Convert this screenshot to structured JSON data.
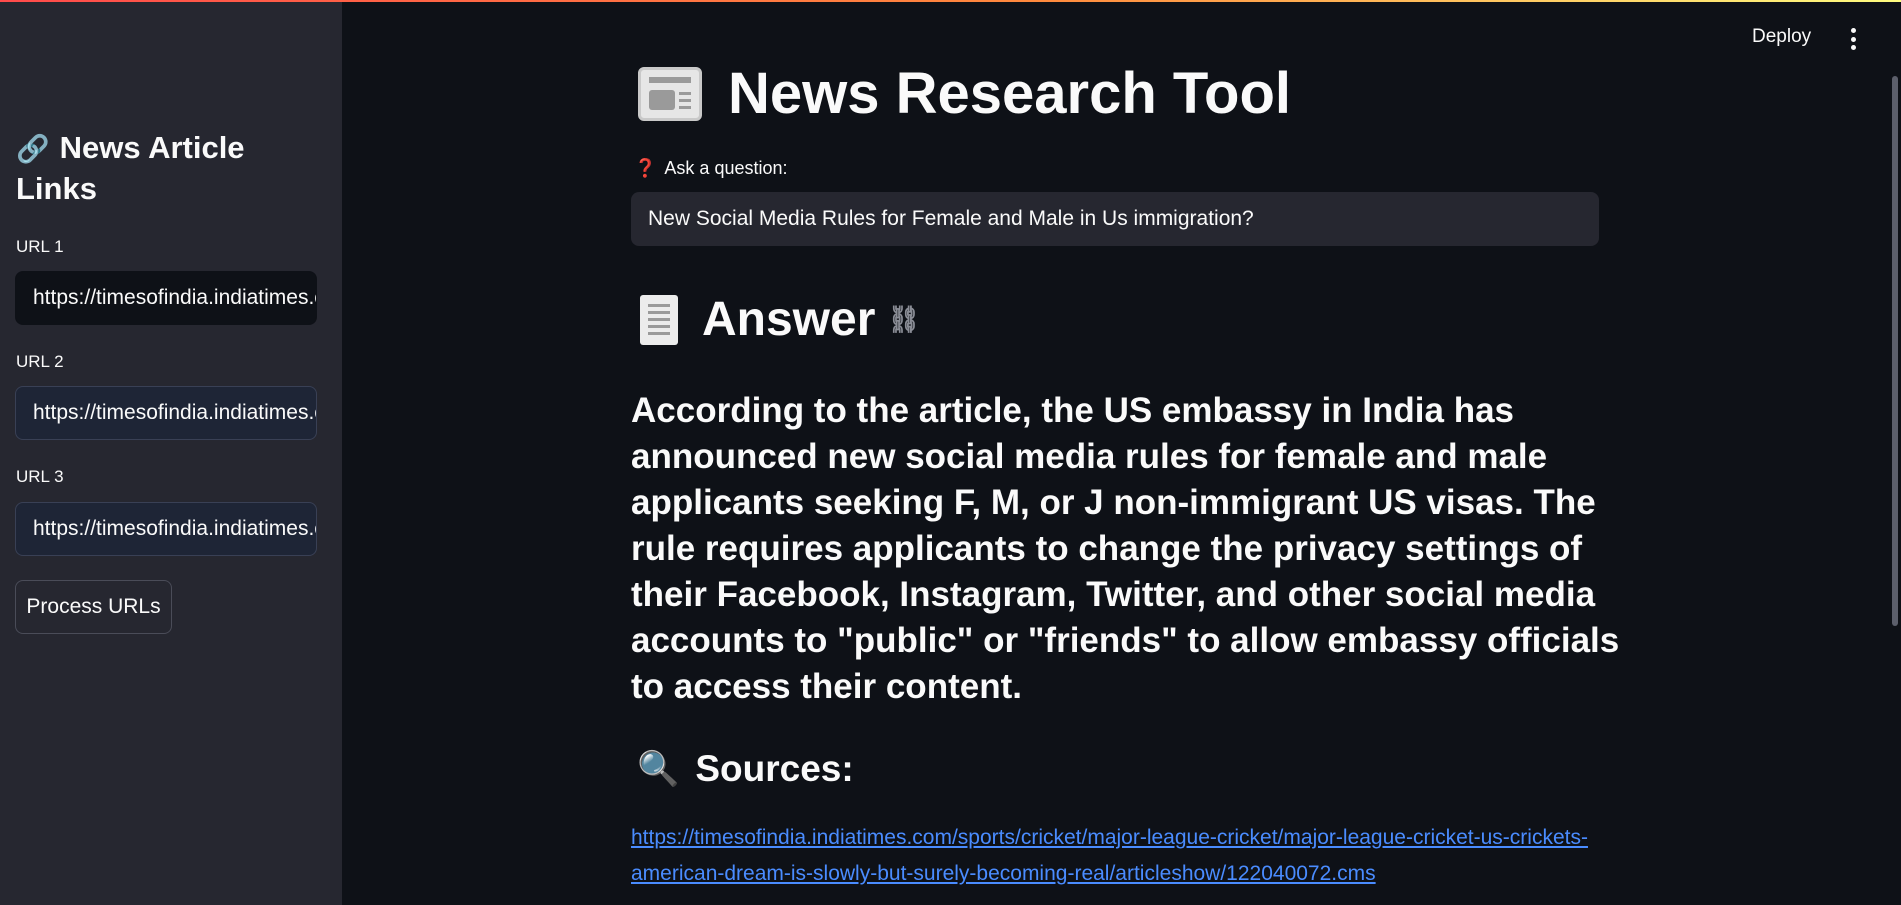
{
  "sidebar": {
    "title_icon": "🔗",
    "title": "News Article Links",
    "urls": [
      {
        "label": "URL 1",
        "value": "https://timesofindia.indiatimes.com/"
      },
      {
        "label": "URL 2",
        "value": "https://timesofindia.indiatimes.com/"
      },
      {
        "label": "URL 3",
        "value": "https://timesofindia.indiatimes.com/"
      }
    ],
    "process_button": "Process URLs"
  },
  "header": {
    "deploy_label": "Deploy",
    "menu_icon": "more-vert-icon"
  },
  "main": {
    "title": "News Research Tool",
    "title_icon": "newspaper-icon",
    "question_label": "Ask a question:",
    "question_icon": "❓",
    "question_value": "New Social Media Rules for Female and Male in Us immigration?",
    "answer_heading": "Answer",
    "answer_icon": "receipt-icon",
    "anchor_icon": "⛓",
    "answer_text": "According to the article, the US embassy in India has announced new social media rules for female and male applicants seeking F, M, or J non-immigrant US visas. The rule requires applicants to change the privacy settings of their Facebook, Instagram, Twitter, and other social media accounts to \"public\" or \"friends\" to allow embassy officials to access their content.",
    "sources_heading": "Sources:",
    "sources_icon": "🔍",
    "sources": [
      "https://timesofindia.indiatimes.com/sports/cricket/major-league-cricket/major-league-cricket-us-crickets-american-dream-is-slowly-but-surely-becoming-real/articleshow/122040072.cms"
    ]
  },
  "colors": {
    "background": "#0e1117",
    "sidebar": "#262730",
    "link": "#4a8cff",
    "accent": "#ff4b4b"
  }
}
